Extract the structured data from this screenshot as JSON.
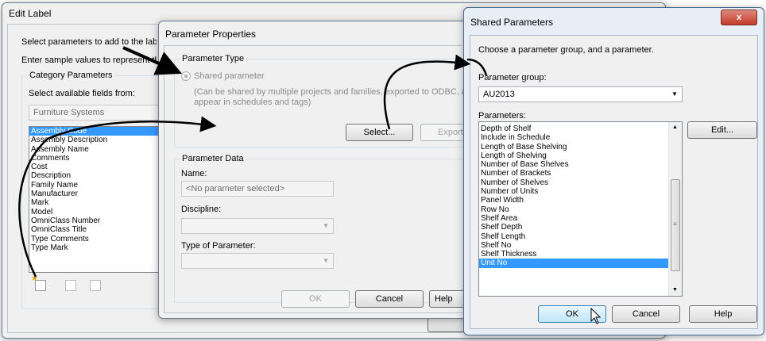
{
  "edit_label": {
    "title": "Edit Label",
    "instructions1": "Select parameters to add to the label.",
    "instructions2": "Enter sample values to represent this",
    "category_group": "Category Parameters",
    "select_fields_label": "Select available fields from:",
    "category_value": "Furniture Systems",
    "fields": [
      "Assembly Code",
      "Assembly Description",
      "Assembly Name",
      "Comments",
      "Cost",
      "Description",
      "Family Name",
      "Manufacturer",
      "Mark",
      "Model",
      "OmniClass Number",
      "OmniClass Title",
      "Type Comments",
      "Type Mark"
    ],
    "selected_field": "Assembly Code"
  },
  "param_props": {
    "title": "Parameter Properties",
    "type_group": "Parameter Type",
    "shared_radio": "Shared parameter",
    "shared_desc1": "(Can be shared by multiple projects and families, exported to ODBC, and",
    "shared_desc2": "appear in schedules and tags)",
    "select_btn": "Select...",
    "export_btn": "Export...",
    "data_group": "Parameter Data",
    "name_label": "Name:",
    "name_value": "<No parameter selected>",
    "discipline_label": "Discipline:",
    "type_label": "Type of Parameter:",
    "ok_btn": "OK",
    "cancel_btn": "Cancel",
    "help_btn": "Help"
  },
  "shared_params": {
    "title": "Shared Parameters",
    "instruction": "Choose a parameter group, and a parameter.",
    "group_label": "Parameter group:",
    "group_value": "AU2013",
    "params_label": "Parameters:",
    "params": [
      "Depth of Shelf",
      "Include in Schedule",
      "Length of Base Shelving",
      "Length of Shelving",
      "Number of Base Shelves",
      "Number of Brackets",
      "Number of Shelves",
      "Number of Units",
      "Panel Width",
      "Row No",
      "Shelf Area",
      "Shelf Depth",
      "Shelf Length",
      "Shelf No",
      "Shelf Thickness",
      "Unit No"
    ],
    "selected_param": "Unit No",
    "edit_btn": "Edit...",
    "ok_btn": "OK",
    "cancel_btn": "Cancel",
    "help_btn": "Help",
    "close_glyph": "x"
  },
  "colors": {
    "selection": "#3399ff",
    "close_button": "#c75050",
    "annotation_arrow": "#000000"
  }
}
